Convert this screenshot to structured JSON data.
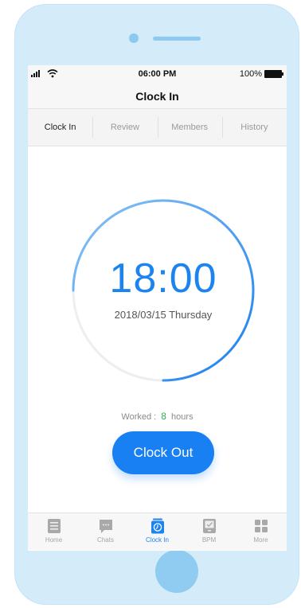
{
  "status_bar": {
    "time": "06:00 PM",
    "battery": "100%"
  },
  "nav": {
    "title": "Clock In"
  },
  "tabs": [
    {
      "label": "Clock In",
      "active": true
    },
    {
      "label": "Review",
      "active": false
    },
    {
      "label": "Members",
      "active": false
    },
    {
      "label": "History",
      "active": false
    }
  ],
  "clock": {
    "time": "18:00",
    "date": "2018/03/15 Thursday"
  },
  "worked": {
    "label": "Worked :",
    "hours": "8",
    "unit": "hours"
  },
  "clock_out_button": {
    "label": "Clock Out"
  },
  "tab_bar": [
    {
      "label": "Home",
      "icon": "home-icon",
      "active": false
    },
    {
      "label": "Chats",
      "icon": "chat-icon",
      "active": false
    },
    {
      "label": "Clock In",
      "icon": "clock-in-icon",
      "active": true
    },
    {
      "label": "BPM",
      "icon": "bpm-icon",
      "active": false
    },
    {
      "label": "More",
      "icon": "more-icon",
      "active": false
    }
  ],
  "colors": {
    "accent": "#1b84f0",
    "ring_track": "#eeeeee",
    "worked_hours": "#2bb24c",
    "frame": "#d4ebfa"
  }
}
